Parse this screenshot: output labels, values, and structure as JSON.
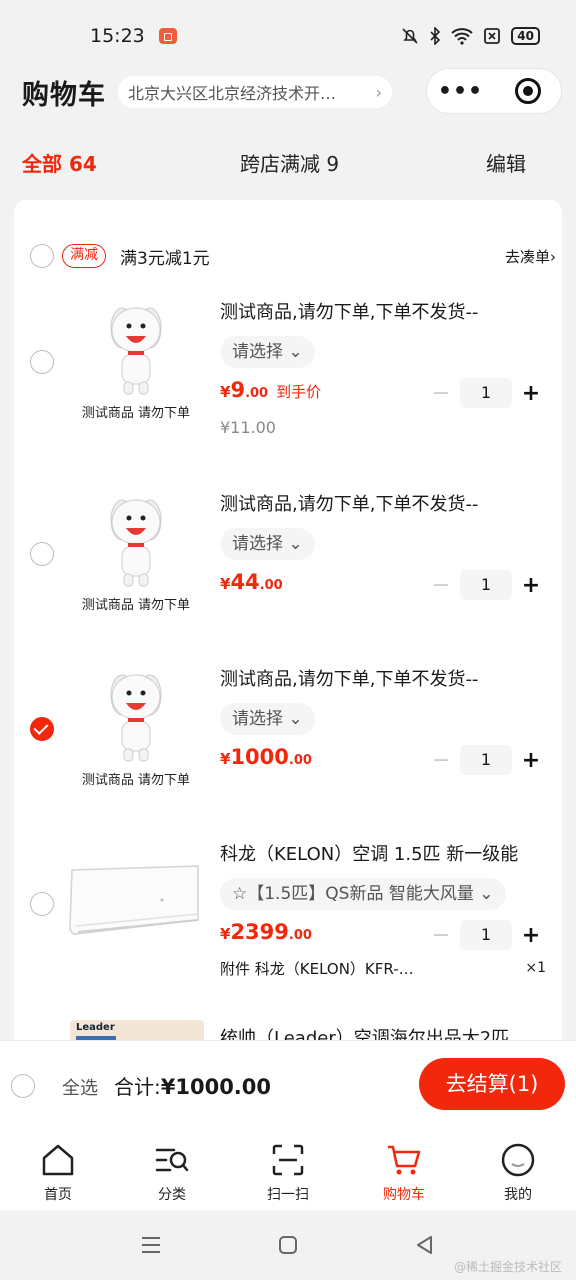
{
  "status_bar": {
    "time": "15:23",
    "battery": "40"
  },
  "header": {
    "title": "购物车",
    "address": "北京大兴区北京经济技术开…",
    "address_chevron": "›",
    "menu_label": "•••"
  },
  "tabs": {
    "all": "全部 64",
    "cross_store": "跨店满减 9",
    "edit": "编辑"
  },
  "promo": {
    "tag": "满减",
    "text": "满3元减1元",
    "link": "去凑单›"
  },
  "items": [
    {
      "name": "测试商品,请勿下单,下单不发货--",
      "spec": "请选择 ⌄",
      "yen": "¥",
      "price_int": "9",
      "price_dec": ".00",
      "price_note": "到手价",
      "original": "¥11.00",
      "qty": "1",
      "thumb_caption": "测试商品  请勿下单",
      "checked": false
    },
    {
      "name": "测试商品,请勿下单,下单不发货--",
      "spec": "请选择 ⌄",
      "yen": "¥",
      "price_int": "44",
      "price_dec": ".00",
      "qty": "1",
      "thumb_caption": "测试商品  请勿下单",
      "checked": false
    },
    {
      "name": "测试商品,请勿下单,下单不发货--",
      "spec": "请选择 ⌄",
      "yen": "¥",
      "price_int": "1000",
      "price_dec": ".00",
      "qty": "1",
      "thumb_caption": "测试商品  请勿下单",
      "checked": true
    },
    {
      "name": "科龙（KELON）空调 1.5匹 新一级能",
      "spec": "☆【1.5匹】QS新品 智能大风量 ⌄",
      "yen": "¥",
      "price_int": "2399",
      "price_dec": ".00",
      "qty": "1",
      "addon": "附件 科龙（KELON）KFR-…",
      "addon_count": "×1",
      "checked": false
    },
    {
      "name": "统帅（Leader）空调海尔出品大2匹",
      "thumb_brand": "Leader",
      "checked": false
    }
  ],
  "footer": {
    "select_all": "全选",
    "total_label": "合计:",
    "total_value": "¥1000.00",
    "checkout": "去结算(1)"
  },
  "tabbar": [
    {
      "label": "首页",
      "icon": "home-icon"
    },
    {
      "label": "分类",
      "icon": "category-search-icon"
    },
    {
      "label": "扫一扫",
      "icon": "scan-icon"
    },
    {
      "label": "购物车",
      "icon": "cart-icon",
      "active": true
    },
    {
      "label": "我的",
      "icon": "profile-icon"
    }
  ],
  "watermark": "@稀土掘金技术社区",
  "colors": {
    "accent": "#f2270c",
    "background": "#f2f2f2"
  }
}
